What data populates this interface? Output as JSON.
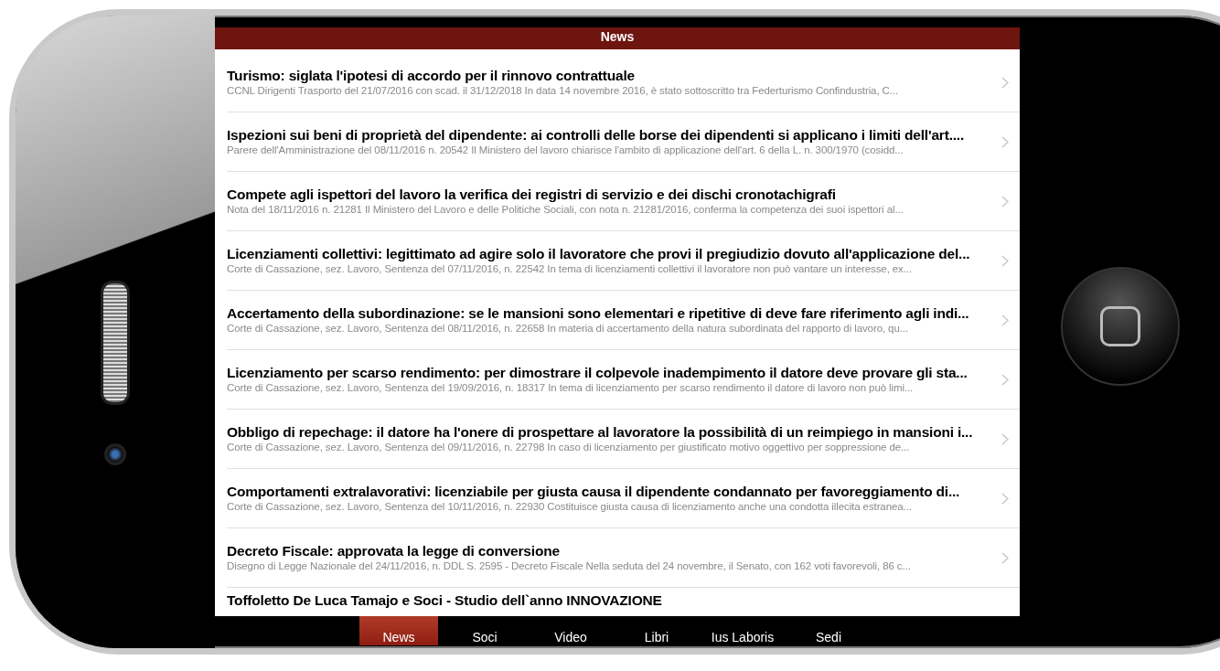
{
  "header": {
    "title": "News"
  },
  "news": [
    {
      "title": "Turismo: siglata l'ipotesi di accordo per il rinnovo contrattuale",
      "summary": "CCNL Dirigenti Trasporto del 21/07/2016 con scad. il 31/12/2018 In data 14 novembre 2016, è stato sottoscritto tra Federturismo Confindustria, C..."
    },
    {
      "title": "Ispezioni sui beni di proprietà del dipendente: ai controlli delle borse dei dipendenti si applicano i limiti dell'art....",
      "summary": "Parere dell'Amministrazione del 08/11/2016 n. 20542 Il Ministero del lavoro chiarisce l'ambito di applicazione dell'art. 6 della L. n. 300/1970 (cosidd..."
    },
    {
      "title": "Compete agli ispettori del lavoro la verifica dei registri di servizio e dei dischi cronotachigrafi",
      "summary": "Nota del 18/11/2016 n. 21281 Il Ministero del Lavoro e delle Politiche Sociali, con nota n. 21281/2016, conferma la competenza dei suoi ispettori al..."
    },
    {
      "title": "Licenziamenti collettivi: legittimato ad agire solo il lavoratore che provi il pregiudizio dovuto all'applicazione del...",
      "summary": "Corte di Cassazione, sez. Lavoro, Sentenza del 07/11/2016, n. 22542 In tema di licenziamenti collettivi il lavoratore non può vantare un interesse, ex..."
    },
    {
      "title": "Accertamento della subordinazione: se le mansioni sono elementari e ripetitive di deve fare riferimento agli indi...",
      "summary": "Corte di Cassazione, sez. Lavoro, Sentenza del 08/11/2016, n. 22658 In materia di accertamento della natura subordinata del rapporto di lavoro, qu..."
    },
    {
      "title": "Licenziamento per scarso rendimento: per dimostrare il colpevole inadempimento il datore deve provare gli sta...",
      "summary": "Corte di Cassazione, sez. Lavoro, Sentenza del 19/09/2016, n. 18317 In tema di licenziamento per scarso rendimento il datore di lavoro non può limi..."
    },
    {
      "title": "Obbligo di repechage: il datore ha l'onere di prospettare al lavoratore la possibilità di un reimpiego in mansioni i...",
      "summary": "Corte di Cassazione, sez. Lavoro, Sentenza del 09/11/2016, n. 22798 In caso di licenziamento per giustificato motivo oggettivo per soppressione de..."
    },
    {
      "title": "Comportamenti extralavorativi: licenziabile per giusta causa il dipendente condannato per favoreggiamento di...",
      "summary": "Corte di Cassazione, sez. Lavoro, Sentenza del 10/11/2016, n. 22930 Costituisce giusta causa di licenziamento anche una condotta illecita estranea..."
    },
    {
      "title": "Decreto Fiscale: approvata la legge di conversione",
      "summary": "Disegno di Legge Nazionale del 24/11/2016, n. DDL S. 2595 - Decreto Fiscale Nella seduta del 24 novembre, il Senato, con 162 voti favorevoli, 86 c..."
    },
    {
      "title": "Toffoletto De Luca Tamajo e Soci - Studio dell`anno INNOVAZIONE"
    }
  ],
  "tabs": [
    {
      "label": "News",
      "selected": true
    },
    {
      "label": "Soci",
      "selected": false
    },
    {
      "label": "Video",
      "selected": false
    },
    {
      "label": "Libri",
      "selected": false
    },
    {
      "label": "Ius Laboris",
      "selected": false
    },
    {
      "label": "Sedi",
      "selected": false
    }
  ]
}
